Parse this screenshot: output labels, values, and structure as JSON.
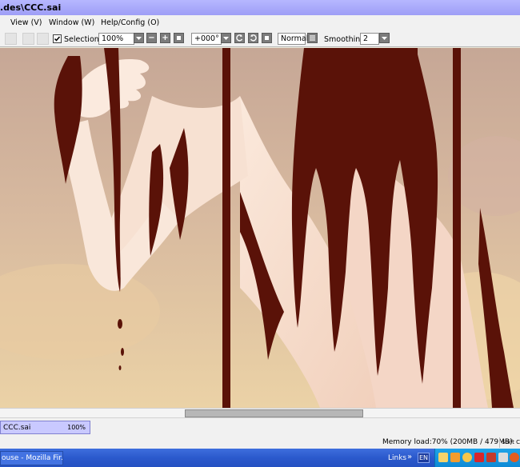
{
  "window": {
    "title": ".des\\CCC.sai"
  },
  "menu": {
    "items": [
      "View (V)",
      "Window (W)",
      "Help/Config (O)"
    ]
  },
  "toolbar": {
    "selection_label": "Selection",
    "selection_checked": true,
    "zoom_value": "100%",
    "minus_label": "−",
    "plus_label": "+",
    "rotation_value": "+000°",
    "blend_mode": "Normal",
    "smoothing_label": "Smoothing",
    "smoothing_value": "2"
  },
  "document_tab": {
    "name": "CCC.sai",
    "zoom": "100%"
  },
  "status": {
    "memory": "Memory load:70% (200MB / 479MB)",
    "keys": "Shift Ctrl"
  },
  "taskbar": {
    "task_label": "ouse - Mozilla Fir...",
    "links_label": "Links",
    "links_arrow": "»",
    "language": "EN"
  },
  "colors": {
    "titlebar": "#a6a6fa",
    "doc_tab": "#c9c9ff",
    "taskbar": "#2b59cc",
    "drip": "#5a1208"
  }
}
